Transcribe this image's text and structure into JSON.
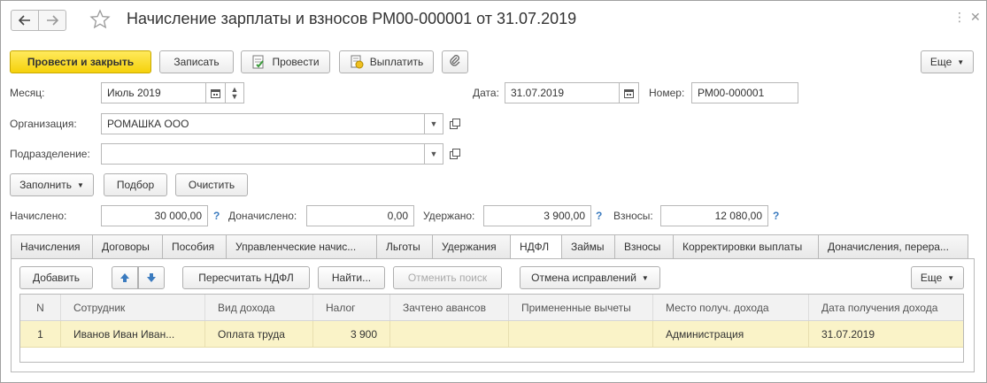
{
  "window": {
    "title": "Начисление зарплаты и взносов РМ00-000001 от 31.07.2019",
    "menu_glyph": "⋮",
    "close_glyph": "✕"
  },
  "toolbar": {
    "post_close": "Провести и закрыть",
    "save": "Записать",
    "post": "Провести",
    "pay": "Выплатить",
    "more": "Еще"
  },
  "header": {
    "month_label": "Месяц:",
    "month_value": "Июль 2019",
    "date_label": "Дата:",
    "date_value": "31.07.2019",
    "number_label": "Номер:",
    "number_value": "РМ00-000001",
    "org_label": "Организация:",
    "org_value": "РОМАШКА ООО",
    "dept_label": "Подразделение:",
    "dept_value": ""
  },
  "actions": {
    "fill": "Заполнить",
    "pick": "Подбор",
    "clear": "Очистить"
  },
  "totals": {
    "accrued_label": "Начислено:",
    "accrued_value": "30 000,00",
    "extra_label": "Доначислено:",
    "extra_value": "0,00",
    "withheld_label": "Удержано:",
    "withheld_value": "3 900,00",
    "contrib_label": "Взносы:",
    "contrib_value": "12 080,00",
    "help": "?"
  },
  "tabs": [
    "Начисления",
    "Договоры",
    "Пособия",
    "Управленческие начис...",
    "Льготы",
    "Удержания",
    "НДФЛ",
    "Займы",
    "Взносы",
    "Корректировки выплаты",
    "Доначисления, перера..."
  ],
  "active_tab": "НДФЛ",
  "tab_toolbar": {
    "add": "Добавить",
    "recalc": "Пересчитать НДФЛ",
    "find": "Найти...",
    "cancel_search": "Отменить поиск",
    "cancel_fixes": "Отмена исправлений",
    "more": "Еще"
  },
  "table": {
    "columns": [
      "N",
      "Сотрудник",
      "Вид дохода",
      "Налог",
      "Зачтено авансов",
      "Примененные вычеты",
      "Место получ. дохода",
      "Дата получения дохода"
    ],
    "rows": [
      [
        "1",
        "Иванов Иван Иван...",
        "Оплата труда",
        "3 900",
        "",
        "",
        "Администрация",
        "31.07.2019"
      ]
    ]
  },
  "colors": {
    "primary_button": "#f5d10b",
    "selected_row": "#faf3c8",
    "help_link": "#3b7bbf"
  }
}
